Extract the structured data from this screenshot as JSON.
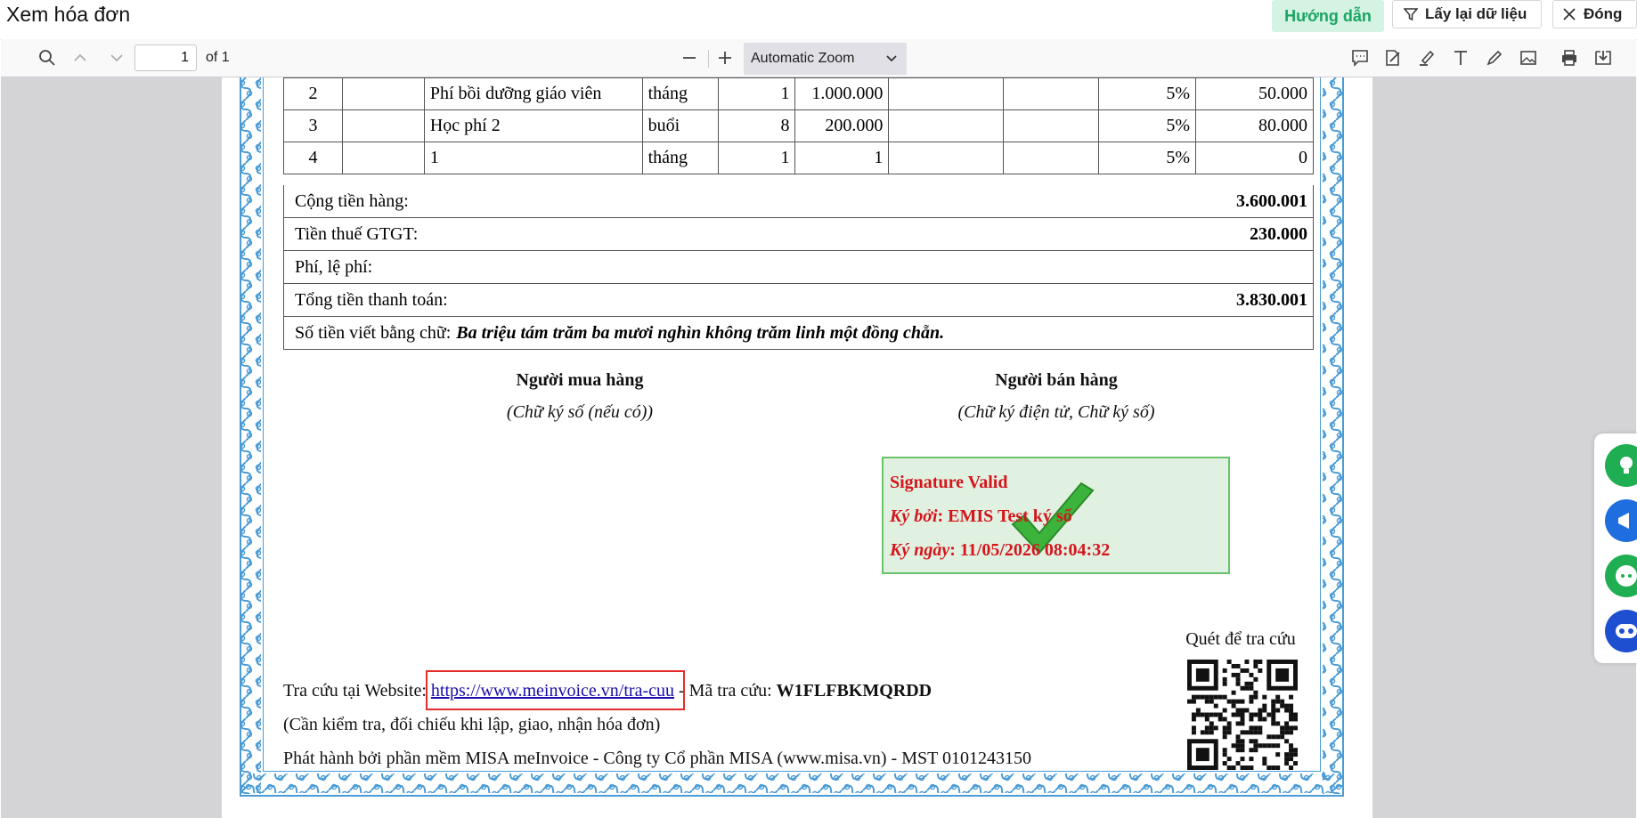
{
  "header": {
    "title": "Xem hóa đơn",
    "guide_label": "Hướng dẫn",
    "reload_label": "Lấy lại dữ liệu",
    "close_label": "Đóng"
  },
  "toolbar": {
    "page_number": "1",
    "page_total": "of 1",
    "zoom": "Automatic Zoom"
  },
  "invoice": {
    "rows": [
      {
        "no": "2",
        "code": "",
        "name": "Phí bồi dưỡng giáo viên",
        "unit": "tháng",
        "qty": "1",
        "price": "1.000.000",
        "c7": "",
        "c8": "",
        "vat": "5%",
        "amount": "50.000"
      },
      {
        "no": "3",
        "code": "",
        "name": "Học phí 2",
        "unit": "buổi",
        "qty": "8",
        "price": "200.000",
        "c7": "",
        "c8": "",
        "vat": "5%",
        "amount": "80.000"
      },
      {
        "no": "4",
        "code": "",
        "name": "1",
        "unit": "tháng",
        "qty": "1",
        "price": "1",
        "c7": "",
        "c8": "",
        "vat": "5%",
        "amount": "0"
      }
    ],
    "subtotal_label": "Cộng tiền hàng:",
    "subtotal_value": "3.600.001",
    "vat_label": "Tiền thuế GTGT:",
    "vat_value": "230.000",
    "fee_label": "Phí, lệ phí:",
    "total_label": "Tổng tiền thanh toán:",
    "total_value": "3.830.001",
    "words_label": "Số tiền viết bằng chữ:",
    "words_value": "Ba triệu tám trăm ba mươi nghìn không trăm linh một đồng chẵn.",
    "buyer_title": "Người mua hàng",
    "buyer_note": "(Chữ ký số (nếu có))",
    "seller_title": "Người bán hàng",
    "seller_note": "(Chữ ký điện tử, Chữ ký số)",
    "sig_valid": "Signature Valid",
    "sig_by_label": "Ký bởi",
    "sig_by_value": ": EMIS Test ký số",
    "sig_date_label": "Ký ngày",
    "sig_date_value": ": 11/05/2026 08:04:32",
    "qr_label": "Quét để tra cứu",
    "lookup_prefix": "Tra cứu tại Website: ",
    "lookup_url": "https://www.meinvoice.vn/tra-cuu",
    "lookup_code_label": " - Mã tra cứu: ",
    "lookup_code": "W1FLFBKMQRDD",
    "check_note": "(Cần kiểm tra, đối chiếu khi lập, giao, nhận hóa đơn)",
    "publisher": "Phát hành bởi phần mềm MISA meInvoice - Công ty Cổ phần MISA (www.misa.vn) - MST 0101243150"
  },
  "colors": {
    "guide_bg": "#d4f3e3",
    "guide_text": "#1aa563",
    "sig_text": "#d4151c",
    "sig_bg": "#e1f1e1",
    "frame_blue": "#4a9bd6",
    "link": "#1a0dab",
    "highlight_box": "#e52b2b"
  },
  "side_actions": [
    {
      "icon": "lightbulb-icon",
      "color": "#1fae51"
    },
    {
      "icon": "megaphone-icon",
      "color": "#1e6ee0"
    },
    {
      "icon": "chat-bot-icon",
      "color": "#1fae51"
    },
    {
      "icon": "assistant-bot-icon",
      "color": "#1e4fd0"
    }
  ]
}
